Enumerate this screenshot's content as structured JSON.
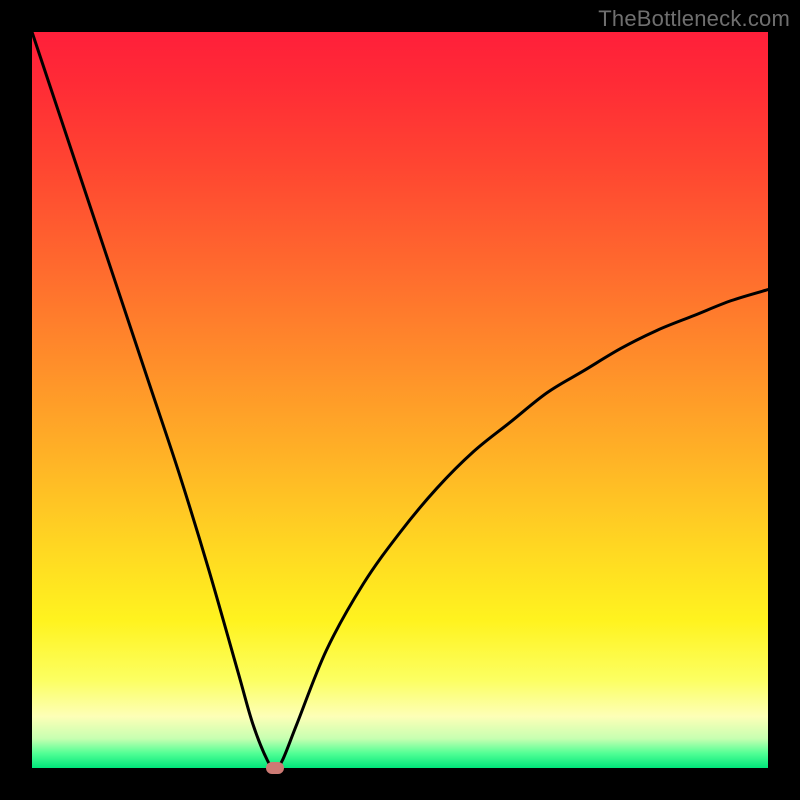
{
  "watermark": "TheBottleneck.com",
  "colors": {
    "page_bg": "#000000",
    "watermark": "#6f6f6f",
    "curve_stroke": "#000000",
    "marker_fill": "#cd7a74",
    "gradient_top": "#ff1f3a",
    "gradient_mid": "#ffd722",
    "gradient_bottom": "#00e57a"
  },
  "chart_data": {
    "type": "line",
    "title": "",
    "xlabel": "",
    "ylabel": "",
    "xlim": [
      0,
      100
    ],
    "ylim": [
      0,
      100
    ],
    "grid": false,
    "legend": false,
    "annotations": [
      {
        "name": "watermark",
        "text": "TheBottleneck.com",
        "position": "top-right"
      }
    ],
    "series": [
      {
        "name": "bottleneck-curve",
        "x": [
          0,
          4,
          8,
          12,
          16,
          20,
          24,
          28,
          30,
          32,
          33,
          34,
          36,
          40,
          45,
          50,
          55,
          60,
          65,
          70,
          75,
          80,
          85,
          90,
          95,
          100
        ],
        "values": [
          100,
          88,
          76,
          64,
          52,
          40,
          27,
          13,
          6,
          1,
          0,
          1,
          6,
          16,
          25,
          32,
          38,
          43,
          47,
          51,
          54,
          57,
          59.5,
          61.5,
          63.5,
          65
        ]
      }
    ],
    "marker": {
      "x": 33,
      "y": 0
    }
  }
}
